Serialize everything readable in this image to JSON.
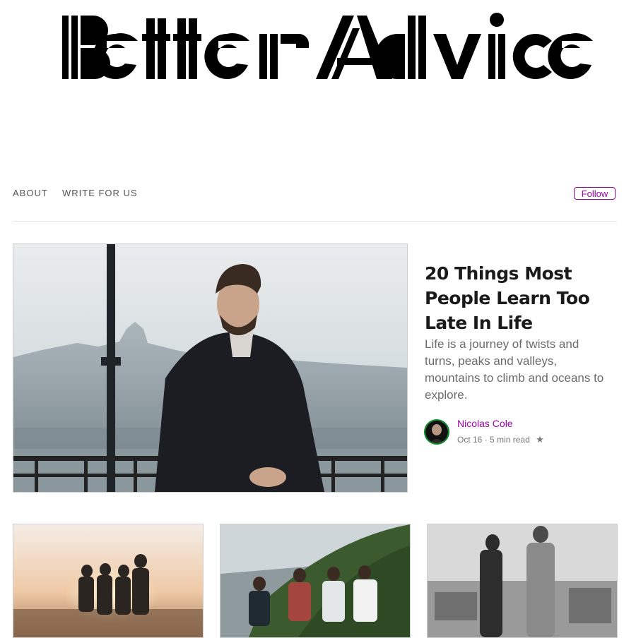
{
  "brand": {
    "logo_text": "BetterAdvice"
  },
  "nav": {
    "items": [
      {
        "label": "ABOUT"
      },
      {
        "label": "WRITE FOR US"
      }
    ],
    "follow_label": "Follow"
  },
  "featured": {
    "title": "20 Things Most People Learn Too Late In Life",
    "excerpt": "Life is a journey of twists and turns, peaks and valleys, mountains to climb and oceans to explore.",
    "author": "Nicolas Cole",
    "date": "Oct 16",
    "separator": "·",
    "read_time": "5 min read",
    "bookmark_icon": "star-icon"
  },
  "colors": {
    "accent": "#a000a8",
    "avatar_ring": "#0a8a28",
    "title": "#1a1a1a",
    "excerpt": "#6b6b6b"
  }
}
